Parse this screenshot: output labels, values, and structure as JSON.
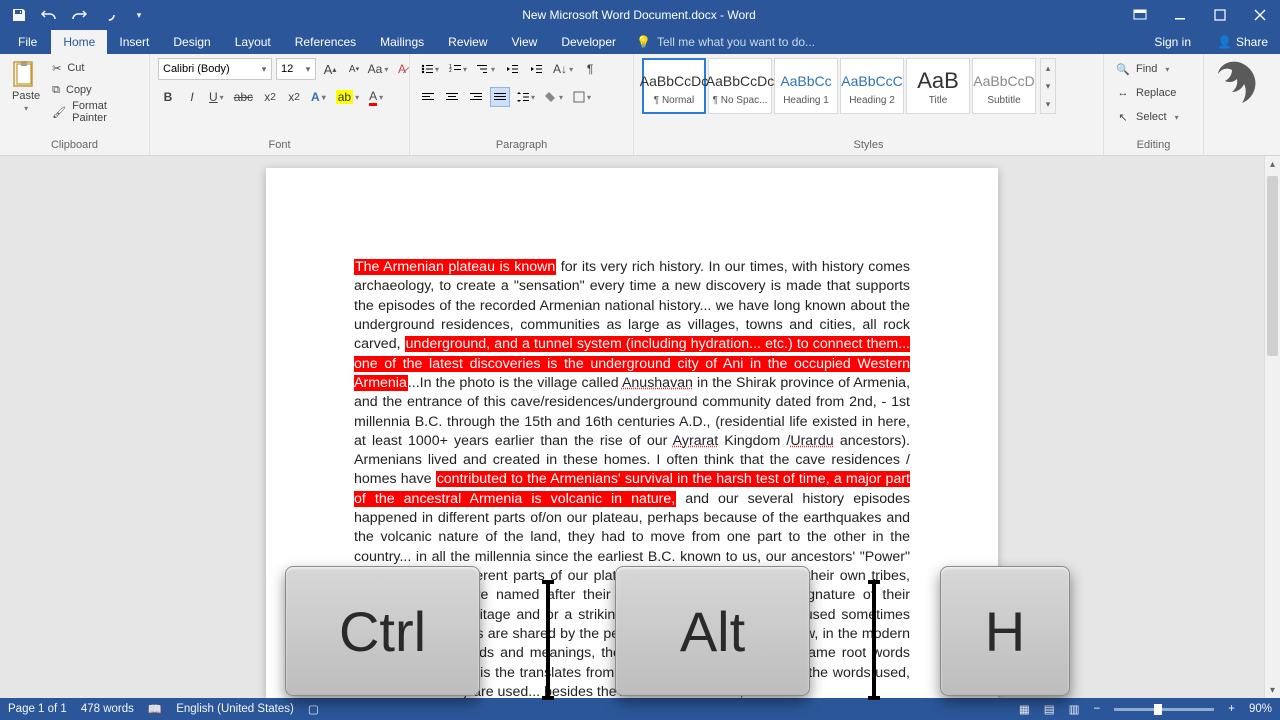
{
  "titlebar": {
    "title": "New Microsoft Word Document.docx - Word"
  },
  "tabs": {
    "file": "File",
    "home": "Home",
    "insert": "Insert",
    "design": "Design",
    "layout": "Layout",
    "references": "References",
    "mailings": "Mailings",
    "review": "Review",
    "view": "View",
    "developer": "Developer",
    "tellme": "Tell me what you want to do...",
    "signin": "Sign in",
    "share": "Share"
  },
  "clipboard": {
    "paste": "Paste",
    "cut": "Cut",
    "copy": "Copy",
    "formatpainter": "Format Painter",
    "label": "Clipboard"
  },
  "font": {
    "name": "Calibri (Body)",
    "size": "12",
    "label": "Font"
  },
  "paragraph": {
    "label": "Paragraph"
  },
  "styles": {
    "label": "Styles",
    "items": [
      {
        "prev": "AaBbCcDc",
        "name": "¶ Normal",
        "blue": false
      },
      {
        "prev": "AaBbCcDc",
        "name": "¶ No Spac...",
        "blue": false
      },
      {
        "prev": "AaBbCc",
        "name": "Heading 1",
        "blue": true
      },
      {
        "prev": "AaBbCcC",
        "name": "Heading 2",
        "blue": true
      },
      {
        "prev": "AaB",
        "name": "Title",
        "blue": false
      },
      {
        "prev": "AaBbCcD",
        "name": "Subtitle",
        "blue": false
      }
    ]
  },
  "editing": {
    "find": "Find",
    "replace": "Replace",
    "select": "Select",
    "label": "Editing"
  },
  "document": {
    "seg1_hl": "The Armenian plateau is known",
    "seg2": " for its very rich history. In our times, with history comes archaeology, to create a \"sensation\" every time a new discovery is made that supports the episodes of the recorded Armenian national history... we have long known about the underground residences, communities as large as villages, towns and cities, all rock carved, ",
    "seg3_hl": "underground, and a tunnel system (including hydration... etc.) to connect them... one of the latest discoveries is the underground city of Ani in the occupied Western Armenia",
    "seg4a": "...In the photo is the village called ",
    "anush": "Anushavan",
    "seg4b": " in the Shirak province of Armenia, and the entrance of this cave/residences/underground community dated from 2nd, - 1st millennia B.C. through the 15th and 16th centuries A.D., (residential life existed in here, at least 1000+ years earlier than the rise of our ",
    "ayr": "Ayrarat",
    "seg4c": " Kingdom /",
    "ura": "Urardu",
    "seg4d": " ancestors). Armenians lived and created in these homes. I often think that the cave residences / homes have ",
    "seg5_hl": "contributed to the Armenians' survival in the harsh test of time, a major part of the ancestral Armenia is volcanic in nature,",
    "seg6": " and our several history episodes happened in different parts of/on our plateau, perhaps because of the earthquakes and the volcanic nature of the land, they had to move from one part to the other in the country... in all the millennia since the earliest B.C. known to us, our ancestors' \"Power\" rose and fell in different parts of our plateau, they bore the names of their own tribes, their kingdoms were named after their tribes and gods... but the signature of their artifacts/cultural heritage and or a striking similarity of the languages used sometimes the same root words are shared by the people on the same land, for now, in the modern number of root words and meanings, the meaning of words are the same root words known in Armenian is the translates from the ancient exact meaning of the words used, in the context they are used... besides the Armenian research, we have"
  },
  "status": {
    "page": "Page 1 of 1",
    "words": "478 words",
    "lang": "English (United States)",
    "zoom": "90%"
  },
  "keys": {
    "ctrl": "Ctrl",
    "alt": "Alt",
    "h": "H"
  }
}
